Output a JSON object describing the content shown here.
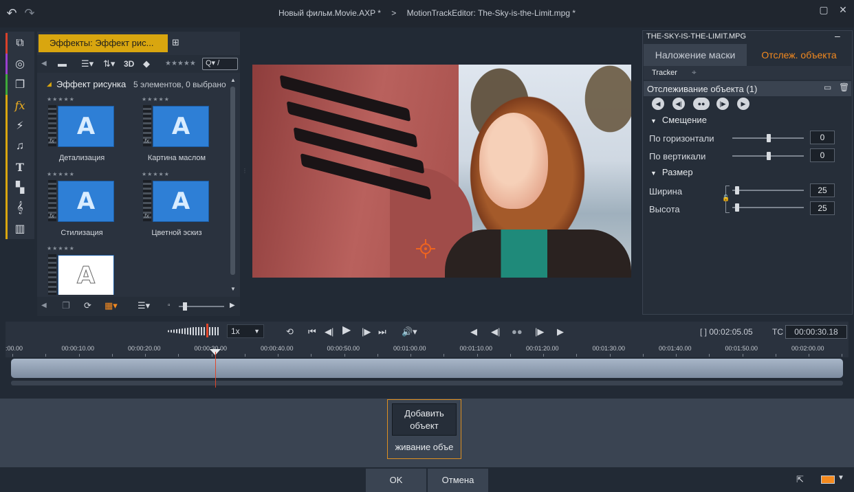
{
  "titlebar": {
    "project": "Новый фильм.Movie.AXP",
    "project_mark": "*",
    "separator": ">",
    "editor": "MotionTrackEditor: The-Sky-is-the-Limit.mpg",
    "editor_mark": "*"
  },
  "library": {
    "tab_label": "Эффекты: Эффект рис...",
    "search_placeholder": "Q▾ /",
    "toolbar_3d": "3D",
    "rating_stars": "★★★★★",
    "header_title": "Эффект рисунка",
    "header_count": "5 элементов, 0 выбрано",
    "items": [
      {
        "label": "Детализация",
        "glyph": "A",
        "stars": "★★★★★"
      },
      {
        "label": "Картина маслом",
        "glyph": "A",
        "stars": "★★★★★"
      },
      {
        "label": "Стилизация",
        "glyph": "A",
        "stars": "★★★★★"
      },
      {
        "label": "Цветной эскиз",
        "glyph": "A",
        "stars": "★★★★★"
      },
      {
        "label": "",
        "glyph": "A",
        "stars": "★★★★★"
      }
    ]
  },
  "right_panel": {
    "clip_title": "THE-SKY-IS-THE-LIMIT.MPG",
    "tab_mask": "Наложение маски",
    "tab_tracking": "Отслеж. объекта",
    "sub_tracker": "Tracker",
    "section_title": "Отслеживание объекта (1)",
    "group_offset": "Смещение",
    "group_size": "Размер",
    "params": {
      "horizontal_label": "По горизонтали",
      "horizontal_value": "0",
      "vertical_label": "По вертикали",
      "vertical_value": "0",
      "width_label": "Ширина",
      "width_value": "25",
      "height_label": "Высота",
      "height_value": "25"
    }
  },
  "transport": {
    "speed": "1x",
    "duration": "[ ] 00:02:05.05",
    "tc_label": "TC",
    "tc_value": "00:00:30.18"
  },
  "ruler": {
    "labels": [
      ":00.00",
      "00:00:10.00",
      "00:00:20.00",
      "00:00:30.00",
      "00:00:40.00",
      "00:00:50.00",
      "00:01:00.00",
      "00:01:10.00",
      "00:01:20.00",
      "00:01:30.00",
      "00:01:40.00",
      "00:01:50.00",
      "00:02:00.00"
    ]
  },
  "bottom": {
    "add_button": "Добавить объект",
    "add_caption": "живание объе",
    "ok": "OK",
    "cancel": "Отмена"
  },
  "colors": {
    "accent_orange": "#f48a1f",
    "tab_yellow": "#d9a60f",
    "playhead": "#e0462a",
    "thumb_blue": "#2e7fd6"
  }
}
